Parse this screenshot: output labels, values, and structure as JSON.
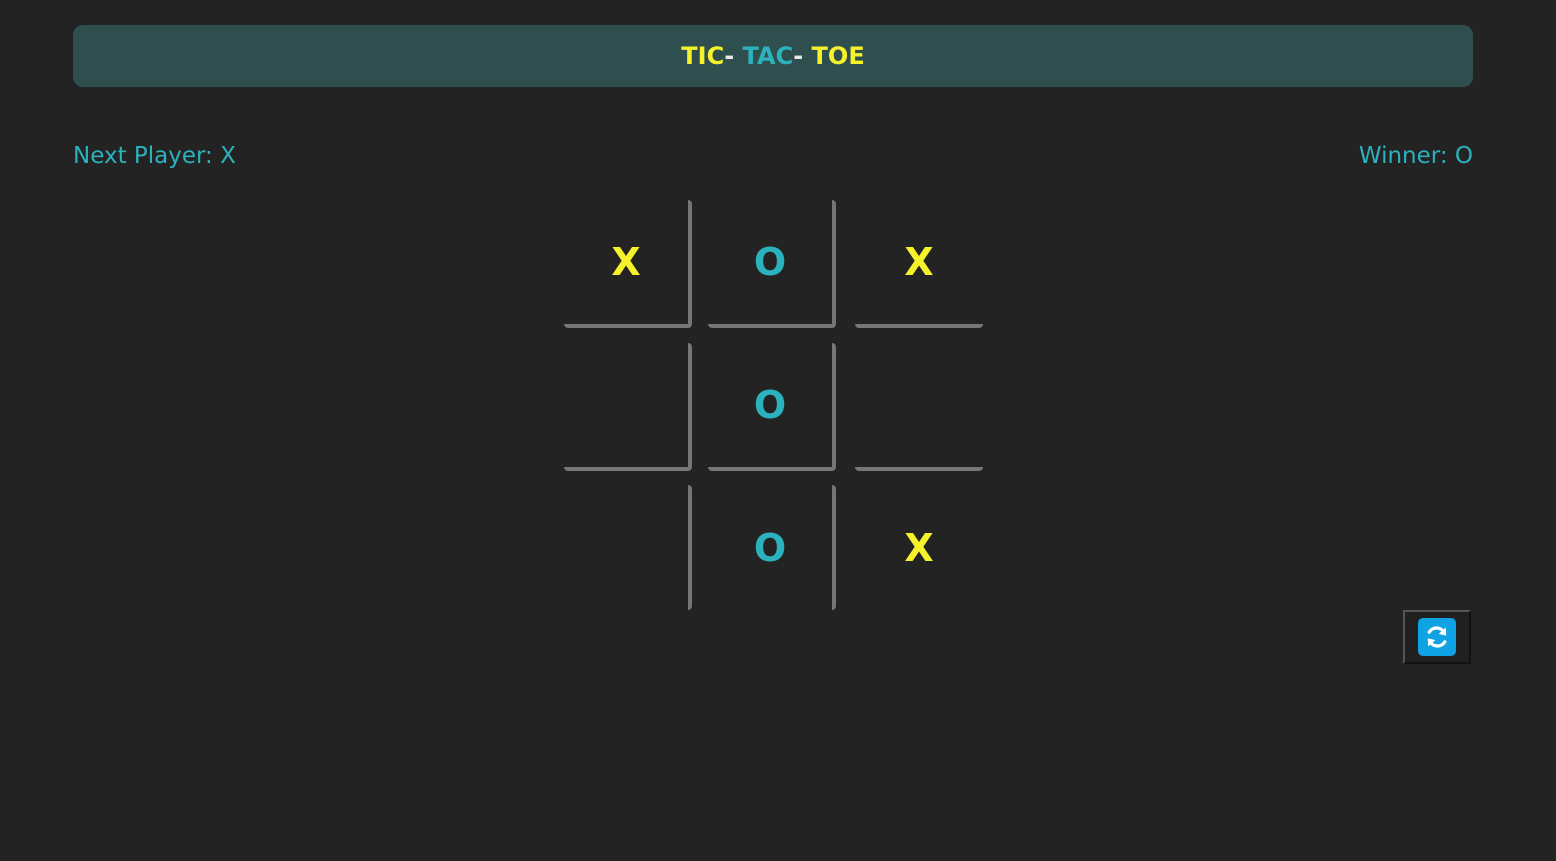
{
  "title": {
    "part1": "TIC",
    "sep1": "- ",
    "part2": "TAC",
    "sep2": "- ",
    "part3": "TOE"
  },
  "status": {
    "next_player": "Next Player: X",
    "winner": "Winner: O"
  },
  "board": {
    "cells": [
      "X",
      "O",
      "X",
      "",
      "O",
      "",
      "",
      "O",
      "X"
    ]
  },
  "reset_button": {
    "icon": "refresh-icon"
  },
  "colors": {
    "background": "#232323",
    "header": "#2f4f4f",
    "x_mark": "#f5f22c",
    "o_mark": "#2bb2bd",
    "grid_line": "#767676",
    "reset_icon": "#10a3e3"
  }
}
